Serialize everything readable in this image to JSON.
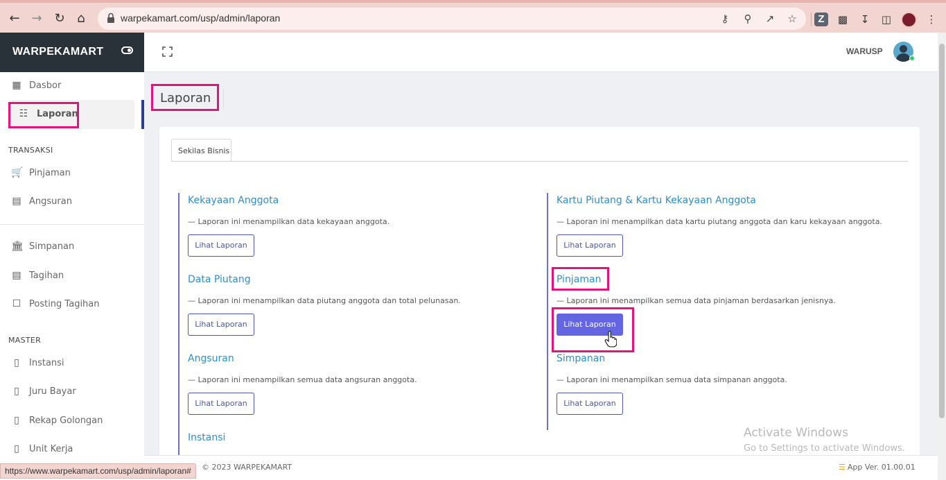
{
  "browser": {
    "url": "warpekamart.com/usp/admin/laporan",
    "status_url": "https://www.warpekamart.com/usp/admin/laporan#"
  },
  "brand": {
    "name": "WARPEKAMART"
  },
  "sidebar": {
    "top_items": [
      {
        "label": "Dasbor",
        "icon": "dashboard-icon"
      },
      {
        "label": "Laporan",
        "icon": "clipboard-icon",
        "active": true
      }
    ],
    "sections": [
      {
        "title": "TRANSAKSI",
        "items": [
          {
            "label": "Pinjaman",
            "icon": "cart-icon"
          },
          {
            "label": "Angsuran",
            "icon": "cash-icon"
          }
        ]
      },
      {
        "title": "",
        "items": [
          {
            "label": "Simpanan",
            "icon": "bank-icon"
          },
          {
            "label": "Tagihan",
            "icon": "cash-icon"
          },
          {
            "label": "Posting Tagihan",
            "icon": "note-icon"
          }
        ]
      },
      {
        "title": "MASTER",
        "items": [
          {
            "label": "Instansi",
            "icon": "book-icon"
          },
          {
            "label": "Juru Bayar",
            "icon": "book-icon"
          },
          {
            "label": "Rekap Golongan",
            "icon": "book-icon"
          },
          {
            "label": "Unit Kerja",
            "icon": "book-icon"
          }
        ]
      }
    ]
  },
  "topbar": {
    "user": "WARUSP"
  },
  "page": {
    "title": "Laporan"
  },
  "tabs": [
    {
      "label": "Sekilas Bisnis",
      "active": true
    }
  ],
  "reports": [
    {
      "title": "Kekayaan Anggota",
      "desc": "— Laporan ini menampilkan data kekayaan anggota.",
      "button": "Lihat Laporan"
    },
    {
      "title": "Kartu Piutang & Kartu Kekayaan Anggota",
      "desc": "— Laporan ini menampilkan data kartu piutang anggota dan karu kekayaan anggota.",
      "button": "Lihat Laporan"
    },
    {
      "title": "Data Piutang",
      "desc": "— Laporan ini menampilkan data piutang anggota dan total pelunasan.",
      "button": "Lihat Laporan"
    },
    {
      "title": "Pinjaman",
      "desc": "— Laporan ini menampilkan semua data pinjaman berdasarkan jenisnya.",
      "button": "Lihat Laporan",
      "hovered": true
    },
    {
      "title": "Angsuran",
      "desc": "— Laporan ini menampilkan semua data angsuran anggota.",
      "button": "Lihat Laporan"
    },
    {
      "title": "Simpanan",
      "desc": "— Laporan ini menampilkan semua data simpanan anggota.",
      "button": "Lihat Laporan"
    },
    {
      "title": "Instansi"
    }
  ],
  "watermark": {
    "line1": "Activate Windows",
    "line2": "Go to Settings to activate Windows."
  },
  "footer": {
    "copyright": "© 2023 WARPEKAMART",
    "version": "App Ver. 01.00.01"
  },
  "colors": {
    "accent": "#6366e0",
    "link": "#2b8fd1",
    "highlight": "#e0147a",
    "brand_bg": "#2a3239"
  }
}
